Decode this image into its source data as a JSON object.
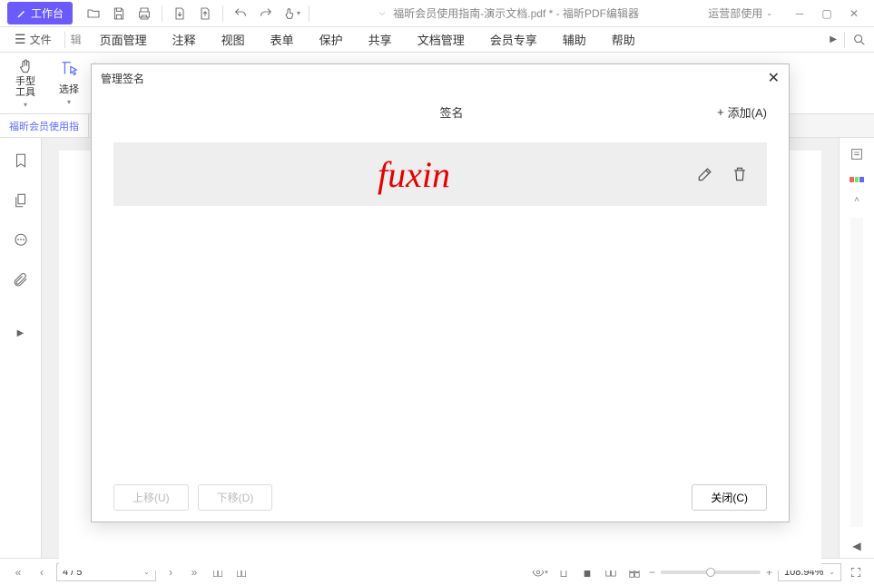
{
  "titlebar": {
    "workspace": "工作台",
    "document_title": "福昕会员使用指南-演示文档.pdf * - 福昕PDF编辑器",
    "user_label": "运营部使用"
  },
  "menubar": {
    "file": "文件",
    "overflow_hint": "辑",
    "items": [
      "页面管理",
      "注释",
      "视图",
      "表单",
      "保护",
      "共享",
      "文档管理",
      "会员专享",
      "辅助",
      "帮助"
    ]
  },
  "toolbar": {
    "hand_tool": "手型\n工具",
    "select_tool": "选择"
  },
  "tabs": {
    "active": "福昕会员使用指"
  },
  "dialog": {
    "title": "管理签名",
    "header": "签名",
    "add_label": "添加(A)",
    "signature_text": "fuxin",
    "move_up": "上移(U)",
    "move_down": "下移(D)",
    "close": "关闭(C)"
  },
  "statusbar": {
    "page": "4 / 5",
    "zoom": "108.94%"
  }
}
